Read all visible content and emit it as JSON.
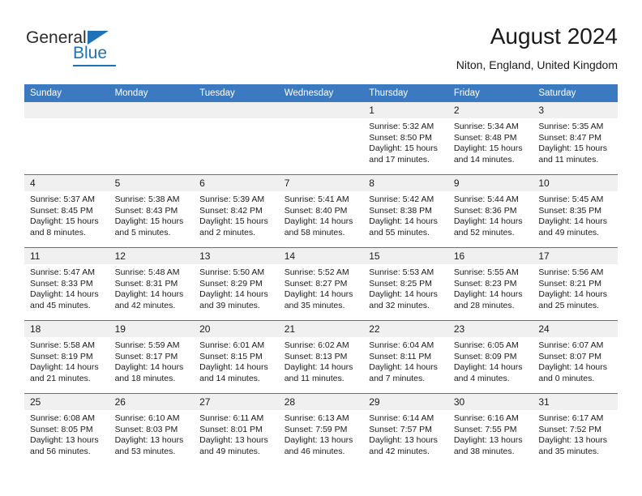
{
  "brand": {
    "name_part1": "General",
    "name_part2": "Blue",
    "triangle_color": "#1f71b8"
  },
  "header": {
    "title": "August 2024",
    "subtitle": "Niton, England, United Kingdom",
    "header_bg": "#3b7ac0",
    "daynum_band_bg": "#f0f0f0"
  },
  "weekdays": [
    "Sunday",
    "Monday",
    "Tuesday",
    "Wednesday",
    "Thursday",
    "Friday",
    "Saturday"
  ],
  "weeks": [
    [
      {
        "day": "",
        "lines": []
      },
      {
        "day": "",
        "lines": []
      },
      {
        "day": "",
        "lines": []
      },
      {
        "day": "",
        "lines": []
      },
      {
        "day": "1",
        "lines": [
          "Sunrise: 5:32 AM",
          "Sunset: 8:50 PM",
          "Daylight: 15 hours",
          "and 17 minutes."
        ]
      },
      {
        "day": "2",
        "lines": [
          "Sunrise: 5:34 AM",
          "Sunset: 8:48 PM",
          "Daylight: 15 hours",
          "and 14 minutes."
        ]
      },
      {
        "day": "3",
        "lines": [
          "Sunrise: 5:35 AM",
          "Sunset: 8:47 PM",
          "Daylight: 15 hours",
          "and 11 minutes."
        ]
      }
    ],
    [
      {
        "day": "4",
        "lines": [
          "Sunrise: 5:37 AM",
          "Sunset: 8:45 PM",
          "Daylight: 15 hours",
          "and 8 minutes."
        ]
      },
      {
        "day": "5",
        "lines": [
          "Sunrise: 5:38 AM",
          "Sunset: 8:43 PM",
          "Daylight: 15 hours",
          "and 5 minutes."
        ]
      },
      {
        "day": "6",
        "lines": [
          "Sunrise: 5:39 AM",
          "Sunset: 8:42 PM",
          "Daylight: 15 hours",
          "and 2 minutes."
        ]
      },
      {
        "day": "7",
        "lines": [
          "Sunrise: 5:41 AM",
          "Sunset: 8:40 PM",
          "Daylight: 14 hours",
          "and 58 minutes."
        ]
      },
      {
        "day": "8",
        "lines": [
          "Sunrise: 5:42 AM",
          "Sunset: 8:38 PM",
          "Daylight: 14 hours",
          "and 55 minutes."
        ]
      },
      {
        "day": "9",
        "lines": [
          "Sunrise: 5:44 AM",
          "Sunset: 8:36 PM",
          "Daylight: 14 hours",
          "and 52 minutes."
        ]
      },
      {
        "day": "10",
        "lines": [
          "Sunrise: 5:45 AM",
          "Sunset: 8:35 PM",
          "Daylight: 14 hours",
          "and 49 minutes."
        ]
      }
    ],
    [
      {
        "day": "11",
        "lines": [
          "Sunrise: 5:47 AM",
          "Sunset: 8:33 PM",
          "Daylight: 14 hours",
          "and 45 minutes."
        ]
      },
      {
        "day": "12",
        "lines": [
          "Sunrise: 5:48 AM",
          "Sunset: 8:31 PM",
          "Daylight: 14 hours",
          "and 42 minutes."
        ]
      },
      {
        "day": "13",
        "lines": [
          "Sunrise: 5:50 AM",
          "Sunset: 8:29 PM",
          "Daylight: 14 hours",
          "and 39 minutes."
        ]
      },
      {
        "day": "14",
        "lines": [
          "Sunrise: 5:52 AM",
          "Sunset: 8:27 PM",
          "Daylight: 14 hours",
          "and 35 minutes."
        ]
      },
      {
        "day": "15",
        "lines": [
          "Sunrise: 5:53 AM",
          "Sunset: 8:25 PM",
          "Daylight: 14 hours",
          "and 32 minutes."
        ]
      },
      {
        "day": "16",
        "lines": [
          "Sunrise: 5:55 AM",
          "Sunset: 8:23 PM",
          "Daylight: 14 hours",
          "and 28 minutes."
        ]
      },
      {
        "day": "17",
        "lines": [
          "Sunrise: 5:56 AM",
          "Sunset: 8:21 PM",
          "Daylight: 14 hours",
          "and 25 minutes."
        ]
      }
    ],
    [
      {
        "day": "18",
        "lines": [
          "Sunrise: 5:58 AM",
          "Sunset: 8:19 PM",
          "Daylight: 14 hours",
          "and 21 minutes."
        ]
      },
      {
        "day": "19",
        "lines": [
          "Sunrise: 5:59 AM",
          "Sunset: 8:17 PM",
          "Daylight: 14 hours",
          "and 18 minutes."
        ]
      },
      {
        "day": "20",
        "lines": [
          "Sunrise: 6:01 AM",
          "Sunset: 8:15 PM",
          "Daylight: 14 hours",
          "and 14 minutes."
        ]
      },
      {
        "day": "21",
        "lines": [
          "Sunrise: 6:02 AM",
          "Sunset: 8:13 PM",
          "Daylight: 14 hours",
          "and 11 minutes."
        ]
      },
      {
        "day": "22",
        "lines": [
          "Sunrise: 6:04 AM",
          "Sunset: 8:11 PM",
          "Daylight: 14 hours",
          "and 7 minutes."
        ]
      },
      {
        "day": "23",
        "lines": [
          "Sunrise: 6:05 AM",
          "Sunset: 8:09 PM",
          "Daylight: 14 hours",
          "and 4 minutes."
        ]
      },
      {
        "day": "24",
        "lines": [
          "Sunrise: 6:07 AM",
          "Sunset: 8:07 PM",
          "Daylight: 14 hours",
          "and 0 minutes."
        ]
      }
    ],
    [
      {
        "day": "25",
        "lines": [
          "Sunrise: 6:08 AM",
          "Sunset: 8:05 PM",
          "Daylight: 13 hours",
          "and 56 minutes."
        ]
      },
      {
        "day": "26",
        "lines": [
          "Sunrise: 6:10 AM",
          "Sunset: 8:03 PM",
          "Daylight: 13 hours",
          "and 53 minutes."
        ]
      },
      {
        "day": "27",
        "lines": [
          "Sunrise: 6:11 AM",
          "Sunset: 8:01 PM",
          "Daylight: 13 hours",
          "and 49 minutes."
        ]
      },
      {
        "day": "28",
        "lines": [
          "Sunrise: 6:13 AM",
          "Sunset: 7:59 PM",
          "Daylight: 13 hours",
          "and 46 minutes."
        ]
      },
      {
        "day": "29",
        "lines": [
          "Sunrise: 6:14 AM",
          "Sunset: 7:57 PM",
          "Daylight: 13 hours",
          "and 42 minutes."
        ]
      },
      {
        "day": "30",
        "lines": [
          "Sunrise: 6:16 AM",
          "Sunset: 7:55 PM",
          "Daylight: 13 hours",
          "and 38 minutes."
        ]
      },
      {
        "day": "31",
        "lines": [
          "Sunrise: 6:17 AM",
          "Sunset: 7:52 PM",
          "Daylight: 13 hours",
          "and 35 minutes."
        ]
      }
    ]
  ]
}
